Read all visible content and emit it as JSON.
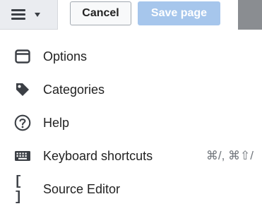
{
  "toolbar": {
    "menu_icon": "hamburger-icon",
    "caret_icon": "caret-down-icon",
    "cancel_label": "Cancel",
    "save_label": "Save page"
  },
  "menu": {
    "items": [
      {
        "icon": "window-icon",
        "label": "Options",
        "shortcut": ""
      },
      {
        "icon": "tag-icon",
        "label": "Categories",
        "shortcut": ""
      },
      {
        "icon": "help-icon",
        "label": "Help",
        "shortcut": ""
      },
      {
        "icon": "keyboard-icon",
        "label": "Keyboard shortcuts",
        "shortcut": "⌘/, ⌘⇧/"
      },
      {
        "icon": "brackets-icon",
        "label": "Source Editor",
        "shortcut": ""
      }
    ]
  },
  "colors": {
    "save_button_disabled": "#a6c6ec",
    "toolbar_menu_bg": "#eaecf0",
    "text": "#222222",
    "shortcut_text": "#72777d"
  }
}
